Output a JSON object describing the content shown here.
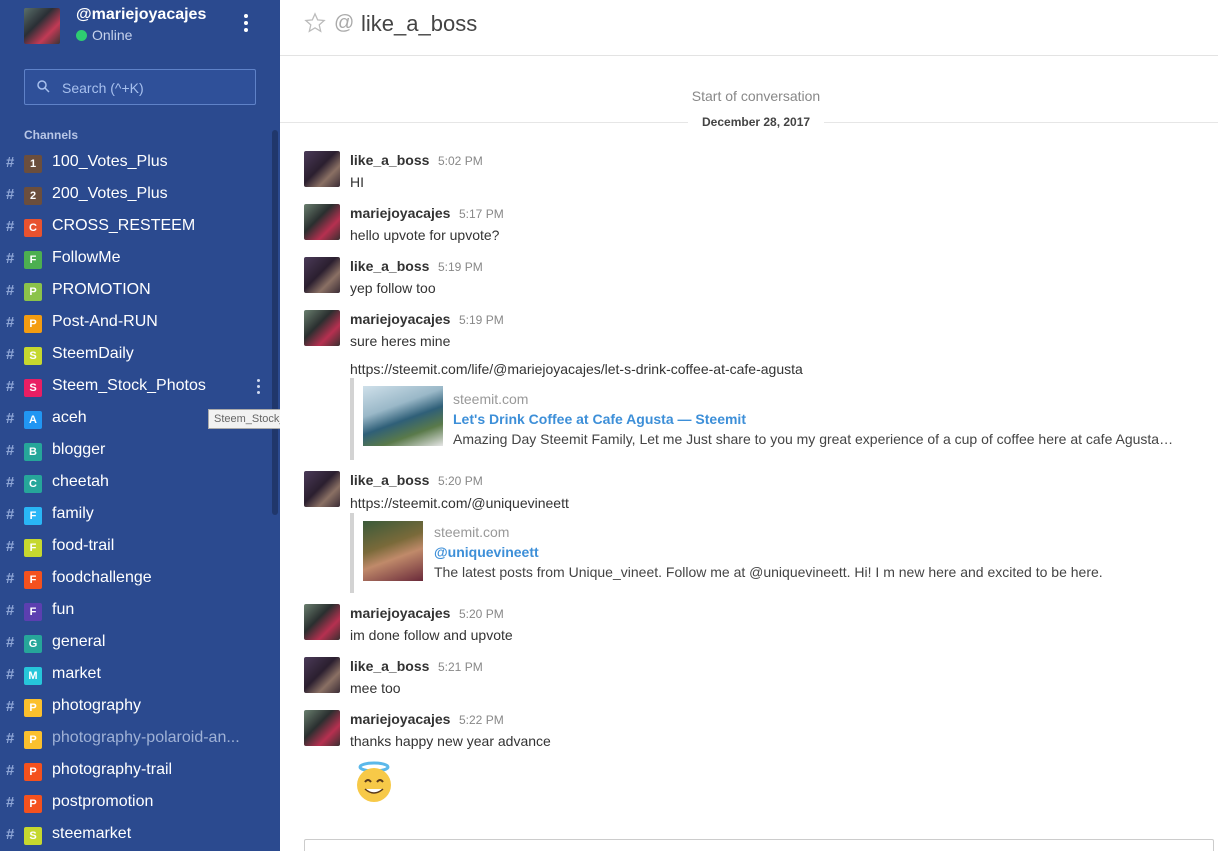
{
  "user": {
    "name": "@mariejoyacajes",
    "status": "Online"
  },
  "search": {
    "placeholder": "Search (^+K)"
  },
  "sidebar": {
    "channels_title": "Channels",
    "channels": [
      {
        "badge": "1",
        "name": "100_Votes_Plus",
        "color": "#6b4e3d"
      },
      {
        "badge": "2",
        "name": "200_Votes_Plus",
        "color": "#6b4e3d"
      },
      {
        "badge": "C",
        "name": "CROSS_RESTEEM",
        "color": "#e8522f"
      },
      {
        "badge": "F",
        "name": "FollowMe",
        "color": "#4caf50"
      },
      {
        "badge": "P",
        "name": "PROMOTION",
        "color": "#8bc34a"
      },
      {
        "badge": "P",
        "name": "Post-And-RUN",
        "color": "#f39c12"
      },
      {
        "badge": "S",
        "name": "SteemDaily",
        "color": "#c6d82f"
      },
      {
        "badge": "S",
        "name": "Steem_Stock_Photos",
        "color": "#e91e63"
      },
      {
        "badge": "A",
        "name": "aceh",
        "color": "#2196f3"
      },
      {
        "badge": "B",
        "name": "blogger",
        "color": "#26a69a"
      },
      {
        "badge": "C",
        "name": "cheetah",
        "color": "#26a69a"
      },
      {
        "badge": "F",
        "name": "family",
        "color": "#29b6f6"
      },
      {
        "badge": "F",
        "name": "food-trail",
        "color": "#c6d82f"
      },
      {
        "badge": "F",
        "name": "foodchallenge",
        "color": "#f4511e"
      },
      {
        "badge": "F",
        "name": "fun",
        "color": "#5c3fb0"
      },
      {
        "badge": "G",
        "name": "general",
        "color": "#26a69a"
      },
      {
        "badge": "M",
        "name": "market",
        "color": "#26c6da"
      },
      {
        "badge": "P",
        "name": "photography",
        "color": "#fbc02d"
      },
      {
        "badge": "P",
        "name": "photography-polaroid-an...",
        "color": "#fbc02d"
      },
      {
        "badge": "P",
        "name": "photography-trail",
        "color": "#f4511e"
      },
      {
        "badge": "P",
        "name": "postpromotion",
        "color": "#f4511e"
      },
      {
        "badge": "S",
        "name": "steemarket",
        "color": "#c6d82f"
      }
    ],
    "tooltip": "Steem_Stock_Photos"
  },
  "room": {
    "title": "like_a_boss"
  },
  "conversation": {
    "start_text": "Start of conversation",
    "date": "December 28, 2017",
    "messages": [
      {
        "author": "like_a_boss",
        "time": "5:02 PM",
        "text": "HI"
      },
      {
        "author": "mariejoyacajes",
        "time": "5:17 PM",
        "text": "hello upvote for upvote?"
      },
      {
        "author": "like_a_boss",
        "time": "5:19 PM",
        "text": "yep follow too"
      },
      {
        "author": "mariejoyacajes",
        "time": "5:19 PM",
        "text": "sure heres mine",
        "link": "https://steemit.com/life/@mariejoyacajes/let-s-drink-coffee-at-cafe-agusta",
        "preview": {
          "site": "steemit.com",
          "title": "Let's Drink Coffee at Cafe Agusta — Steemit",
          "description": "Amazing Day Steemit Family, Let me Just share to you my great experience of a cup of coffee here at cafe Agusta…"
        }
      },
      {
        "author": "like_a_boss",
        "time": "5:20 PM",
        "text": "https://steemit.com/@uniquevineett",
        "preview": {
          "site": "steemit.com",
          "title": "@uniquevineett",
          "description": "The latest posts from Unique_vineet. Follow me at @uniquevineett. Hi! I m new here and excited to be here."
        }
      },
      {
        "author": "mariejoyacajes",
        "time": "5:20 PM",
        "text": "im done follow and upvote"
      },
      {
        "author": "like_a_boss",
        "time": "5:21 PM",
        "text": "mee too"
      },
      {
        "author": "mariejoyacajes",
        "time": "5:22 PM",
        "text": "thanks happy new year advance"
      }
    ]
  }
}
